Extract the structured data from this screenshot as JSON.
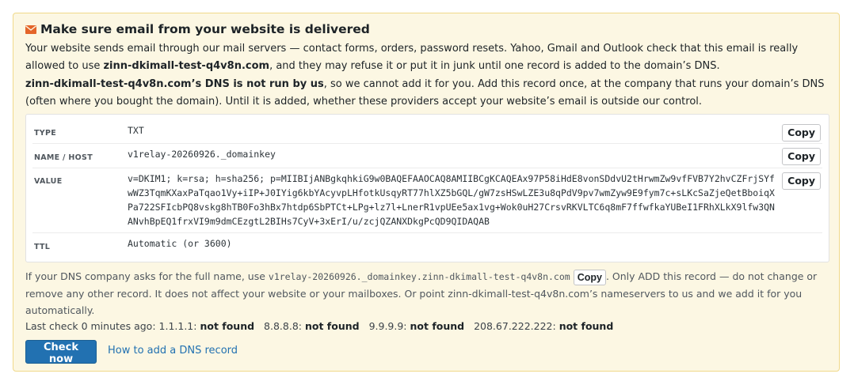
{
  "notice": {
    "title": "Make sure email from your website is delivered",
    "accent_color": "#e4652a",
    "para1": {
      "before": "Your website sends email through our mail servers — contact forms, orders, password resets. Yahoo, Gmail and Outlook check that this email is really allowed to use ",
      "domain": "zinn-dkimall-test-q4v8n.com",
      "after": ", and they may refuse it or put it in junk until one record is added to the domain’s DNS."
    },
    "para2": {
      "bold": "zinn-dkimall-test-q4v8n.com’s DNS is not run by us",
      "after": ", so we cannot add it for you. Add this record once, at the company that runs your domain’s DNS (often where you bought the domain). Until it is added, whether these providers accept your website’s email is outside our control."
    }
  },
  "record": {
    "type_label": "TYPE",
    "type_value": "TXT",
    "name_label": "NAME / HOST",
    "name_value": "v1relay-20260926._domainkey",
    "value_label": "VALUE",
    "value_value": "v=DKIM1; k=rsa; h=sha256; p=MIIBIjANBgkqhkiG9w0BAQEFAAOCAQ8AMIIBCgKCAQEAx97P58iHdE8vonSDdvU2tHrwmZw9vfFVB7Y2hvCZFrjSYfwWZ3TqmKXaxPaTqao1Vy+iIP+J0IYig6kbYAcyvpLHfotkUsqyRT77hlXZ5bGQL/gW7zsHSwLZE3u8qPdV9pv7wmZyw9E9fym7c+sLKcSaZjeQetBboiqXPa722SFIcbPQ8vskg8hTB0Fo3hBx7htdp6SbPTCt+LPg+lz7l+LnerR1vpUEe5ax1vg+Wok0uH27CrsvRKVLTC6q8mF7ffwfkaYUBeI1FRhXLkX9lfw3QNANvhBpEQ1frxVI9m9dmCEzgtL2BIHs7CyV+3xErI/u/zcjQZANXDkgPcQD9QIDAQAB",
    "ttl_label": "TTL",
    "ttl_value": "Automatic (or 3600)",
    "copy_label": "Copy"
  },
  "hint": {
    "before": "If your DNS company asks for the full name, use ",
    "full_name": "v1relay-20260926._domainkey.zinn-dkimall-test-q4v8n.com",
    "copy_label": "Copy",
    "after": ". Only ADD this record — do not change or remove any other record. It does not affect your website or your mailboxes. Or point zinn-dkimall-test-q4v8n.com’s nameservers to us and we add it for you automatically."
  },
  "status": {
    "prefix": "Last check 0 minutes ago:",
    "checks": [
      {
        "resolver": "1.1.1.1:",
        "result": "not found"
      },
      {
        "resolver": "8.8.8.8:",
        "result": "not found"
      },
      {
        "resolver": "9.9.9.9:",
        "result": "not found"
      },
      {
        "resolver": "208.67.222.222:",
        "result": "not found"
      }
    ]
  },
  "actions": {
    "check_now": "Check now",
    "help_link": "How to add a DNS record"
  }
}
